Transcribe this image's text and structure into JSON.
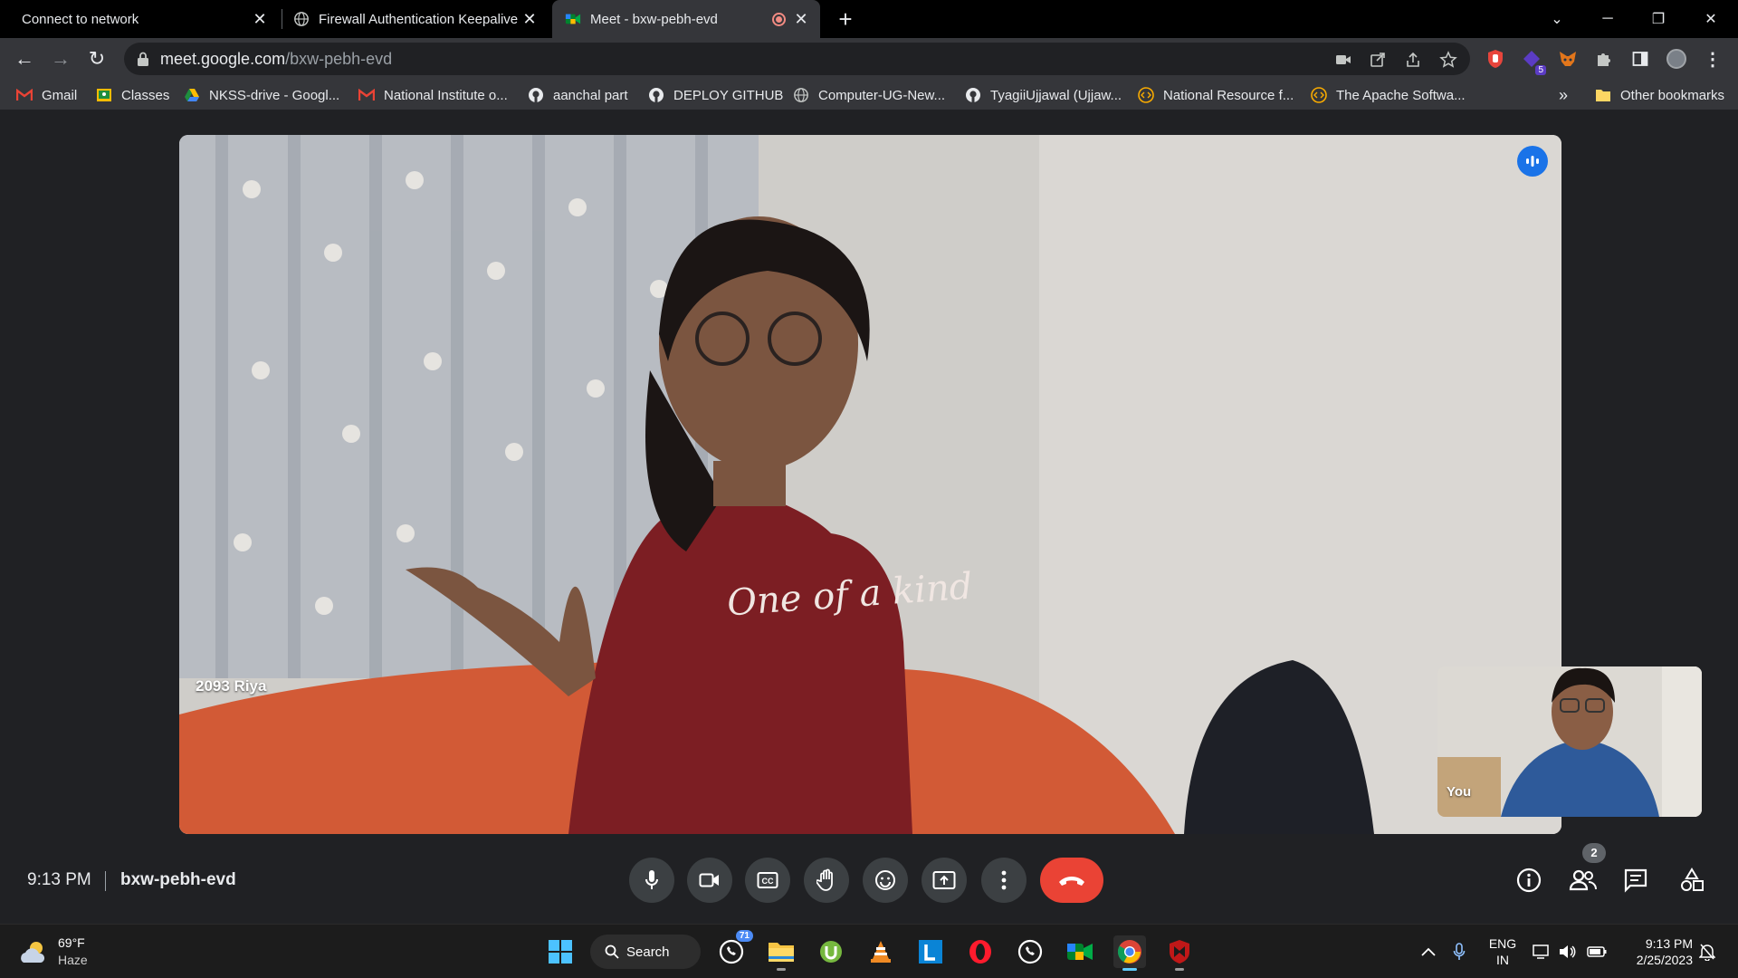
{
  "browser": {
    "tabs": [
      {
        "title": "Connect to network",
        "active": false
      },
      {
        "title": "Firewall Authentication Keepalive",
        "active": false
      },
      {
        "title": "Meet - bxw-pebh-evd",
        "active": true
      }
    ],
    "url_host": "meet.google.com",
    "url_path": "/bxw-pebh-evd",
    "extension_badge": "5",
    "bookmarks": [
      {
        "label": "Gmail",
        "icon": "gmail-icon"
      },
      {
        "label": "Classes",
        "icon": "classroom-icon"
      },
      {
        "label": "NKSS-drive - Googl...",
        "icon": "drive-icon"
      },
      {
        "label": "National Institute o...",
        "icon": "gmail-icon"
      },
      {
        "label": "aanchal part",
        "icon": "github-icon"
      },
      {
        "label": "DEPLOY GITHUB",
        "icon": "github-icon"
      },
      {
        "label": "Computer-UG-New...",
        "icon": "globe-icon"
      },
      {
        "label": "TyagiiUjjawal (Ujjaw...",
        "icon": "github-icon"
      },
      {
        "label": "National Resource f...",
        "icon": "code-icon"
      },
      {
        "label": "The Apache Softwa...",
        "icon": "code-icon"
      }
    ],
    "bookmarks_overflow": "»",
    "other_bookmarks": "Other bookmarks"
  },
  "meet": {
    "main_participant": "2093 Riya",
    "shirt_text": "One of a kind",
    "self_label": "You",
    "time": "9:13 PM",
    "meeting_code": "bxw-pebh-evd",
    "participants_count": "2"
  },
  "taskbar": {
    "weather_temp": "69°F",
    "weather_cond": "Haze",
    "search_label": "Search",
    "whatsapp_badge": "71",
    "lang_line1": "ENG",
    "lang_line2": "IN",
    "time": "9:13 PM",
    "date": "2/25/2023"
  },
  "colors": {
    "hangup": "#ea4335",
    "accent": "#1a73e8",
    "control_bg": "#3c4043"
  }
}
